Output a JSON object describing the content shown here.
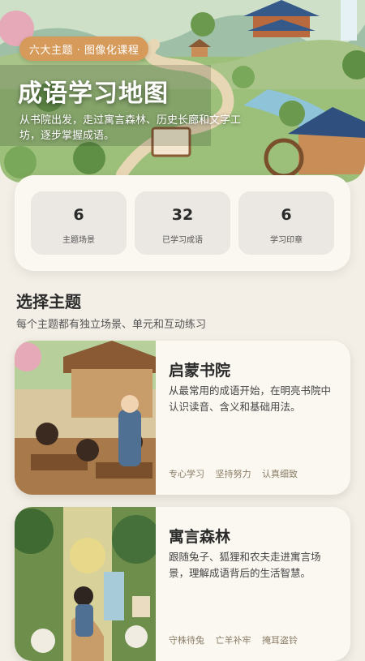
{
  "hero": {
    "pill": "六大主题 · 图像化课程",
    "title": "成语学习地图",
    "subtitle": "从书院出发，走过寓言森林、历史长廊和文字工坊，逐步掌握成语。"
  },
  "stats": [
    {
      "value": "6",
      "label": "主题场景"
    },
    {
      "value": "32",
      "label": "已学习成语"
    },
    {
      "value": "6",
      "label": "学习印章"
    }
  ],
  "section": {
    "title": "选择主题",
    "subtitle": "每个主题都有独立场景、单元和互动练习"
  },
  "topics": [
    {
      "title": "启蒙书院",
      "description": "从最常用的成语开始，在明亮书院中认识读音、含义和基础用法。",
      "tags": [
        "专心学习",
        "坚持努力",
        "认真细致"
      ]
    },
    {
      "title": "寓言森林",
      "description": "跟随兔子、狐狸和农夫走进寓言场景，理解成语背后的生活智慧。",
      "tags": [
        "守株待兔",
        "亡羊补牢",
        "掩耳盗铃"
      ]
    }
  ]
}
